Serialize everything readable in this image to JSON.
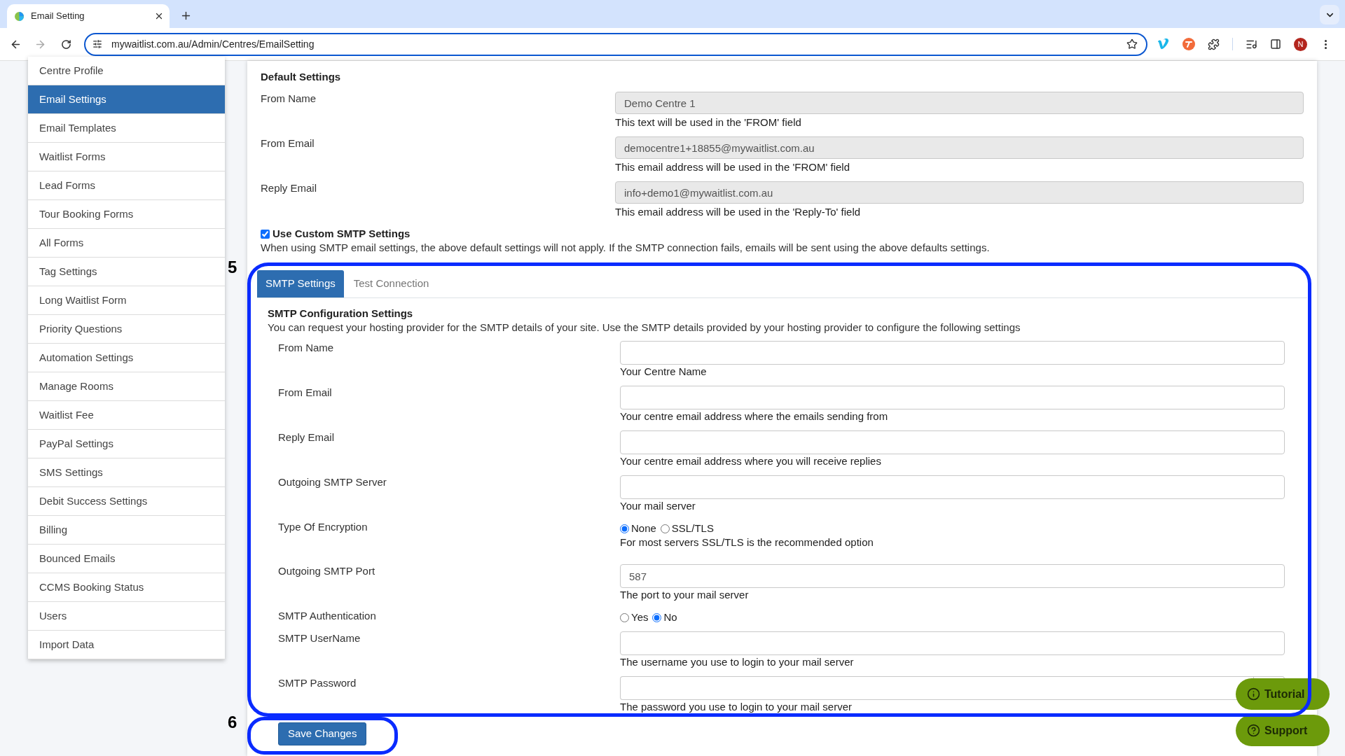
{
  "browser": {
    "tab_title": "Email Setting",
    "url": "mywaitlist.com.au/Admin/Centres/EmailSetting",
    "profile_initial": "N"
  },
  "sidebar": {
    "items": [
      {
        "label": "Centre Profile",
        "selected": false
      },
      {
        "label": "Email Settings",
        "selected": true
      },
      {
        "label": "Email Templates",
        "selected": false
      },
      {
        "label": "Waitlist Forms",
        "selected": false
      },
      {
        "label": "Lead Forms",
        "selected": false
      },
      {
        "label": "Tour Booking Forms",
        "selected": false
      },
      {
        "label": "All Forms",
        "selected": false
      },
      {
        "label": "Tag Settings",
        "selected": false
      },
      {
        "label": "Long Waitlist Form",
        "selected": false
      },
      {
        "label": "Priority Questions",
        "selected": false
      },
      {
        "label": "Automation Settings",
        "selected": false
      },
      {
        "label": "Manage Rooms",
        "selected": false
      },
      {
        "label": "Waitlist Fee",
        "selected": false
      },
      {
        "label": "PayPal Settings",
        "selected": false
      },
      {
        "label": "SMS Settings",
        "selected": false
      },
      {
        "label": "Debit Success Settings",
        "selected": false
      },
      {
        "label": "Billing",
        "selected": false
      },
      {
        "label": "Bounced Emails",
        "selected": false
      },
      {
        "label": "CCMS Booking Status",
        "selected": false
      },
      {
        "label": "Users",
        "selected": false
      },
      {
        "label": "Import Data",
        "selected": false
      }
    ]
  },
  "default_settings": {
    "heading": "Default Settings",
    "fields": [
      {
        "label": "From Name",
        "value": "Demo Centre 1",
        "disabled": true,
        "help": "This text will be used in the 'FROM' field"
      },
      {
        "label": "From Email",
        "value": "democentre1+18855@mywaitlist.com.au",
        "disabled": true,
        "help": "This email address will be used in the 'FROM' field"
      },
      {
        "label": "Reply Email",
        "value": "info+demo1@mywaitlist.com.au",
        "disabled": true,
        "help": "This email address will be used in the 'Reply-To' field"
      }
    ]
  },
  "custom_smtp": {
    "label": "Use Custom SMTP Settings",
    "checked": true,
    "description": "When using SMTP email settings, the above default settings will not apply. If the SMTP connection fails, emails will be sent using the above defaults settings."
  },
  "smtp_tabs": [
    {
      "label": "SMTP Settings",
      "selected": true
    },
    {
      "label": "Test Connection",
      "selected": false
    }
  ],
  "smtp_config": {
    "heading": "SMTP Configuration Settings",
    "description": "You can request your hosting provider for the SMTP details of your site. Use the SMTP details provided by your hosting provider to configure the following settings",
    "fields": [
      {
        "kind": "text",
        "label": "From Name",
        "help": "Your Centre Name"
      },
      {
        "kind": "text",
        "label": "From Email",
        "help": "Your centre email address where the emails sending from"
      },
      {
        "kind": "text",
        "label": "Reply Email",
        "help": "Your centre email address where you will receive replies"
      },
      {
        "kind": "text",
        "label": "Outgoing SMTP Server",
        "help": "Your mail server"
      },
      {
        "kind": "radio",
        "label": "Type Of Encryption",
        "options": [
          {
            "label": "None",
            "selected": true
          },
          {
            "label": "SSL/TLS",
            "selected": false
          }
        ],
        "help": "For most servers SSL/TLS is the recommended option"
      },
      {
        "kind": "text",
        "label": "Outgoing SMTP Port",
        "value": "587",
        "help": "The port to your mail server"
      },
      {
        "kind": "radio",
        "label": "SMTP Authentication",
        "options": [
          {
            "label": "Yes",
            "selected": false
          },
          {
            "label": "No",
            "selected": true
          }
        ]
      },
      {
        "kind": "text",
        "label": "SMTP UserName",
        "help": "The username you use to login to your mail server"
      },
      {
        "kind": "password",
        "label": "SMTP Password",
        "help": "The password you use to login to your mail server"
      }
    ]
  },
  "save_button": "Save Changes",
  "floating_buttons": [
    {
      "kind": "info",
      "label": "Tutorial"
    },
    {
      "kind": "help",
      "label": "Support"
    }
  ],
  "annotations": [
    {
      "label": "5"
    },
    {
      "label": "6"
    }
  ]
}
